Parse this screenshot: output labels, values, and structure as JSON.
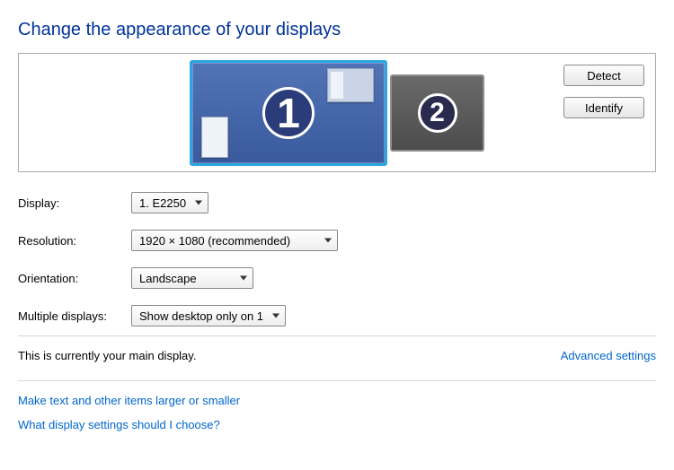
{
  "title": "Change the appearance of your displays",
  "monitors": {
    "primary_number": "1",
    "secondary_number": "2"
  },
  "buttons": {
    "detect": "Detect",
    "identify": "Identify"
  },
  "labels": {
    "display": "Display:",
    "resolution": "Resolution:",
    "orientation": "Orientation:",
    "multiple": "Multiple displays:"
  },
  "values": {
    "display": "1. E2250",
    "resolution": "1920 × 1080 (recommended)",
    "orientation": "Landscape",
    "multiple": "Show desktop only on 1"
  },
  "status": "This is currently your main display.",
  "links": {
    "advanced": "Advanced settings",
    "text_size": "Make text and other items larger or smaller",
    "help": "What display settings should I choose?"
  }
}
